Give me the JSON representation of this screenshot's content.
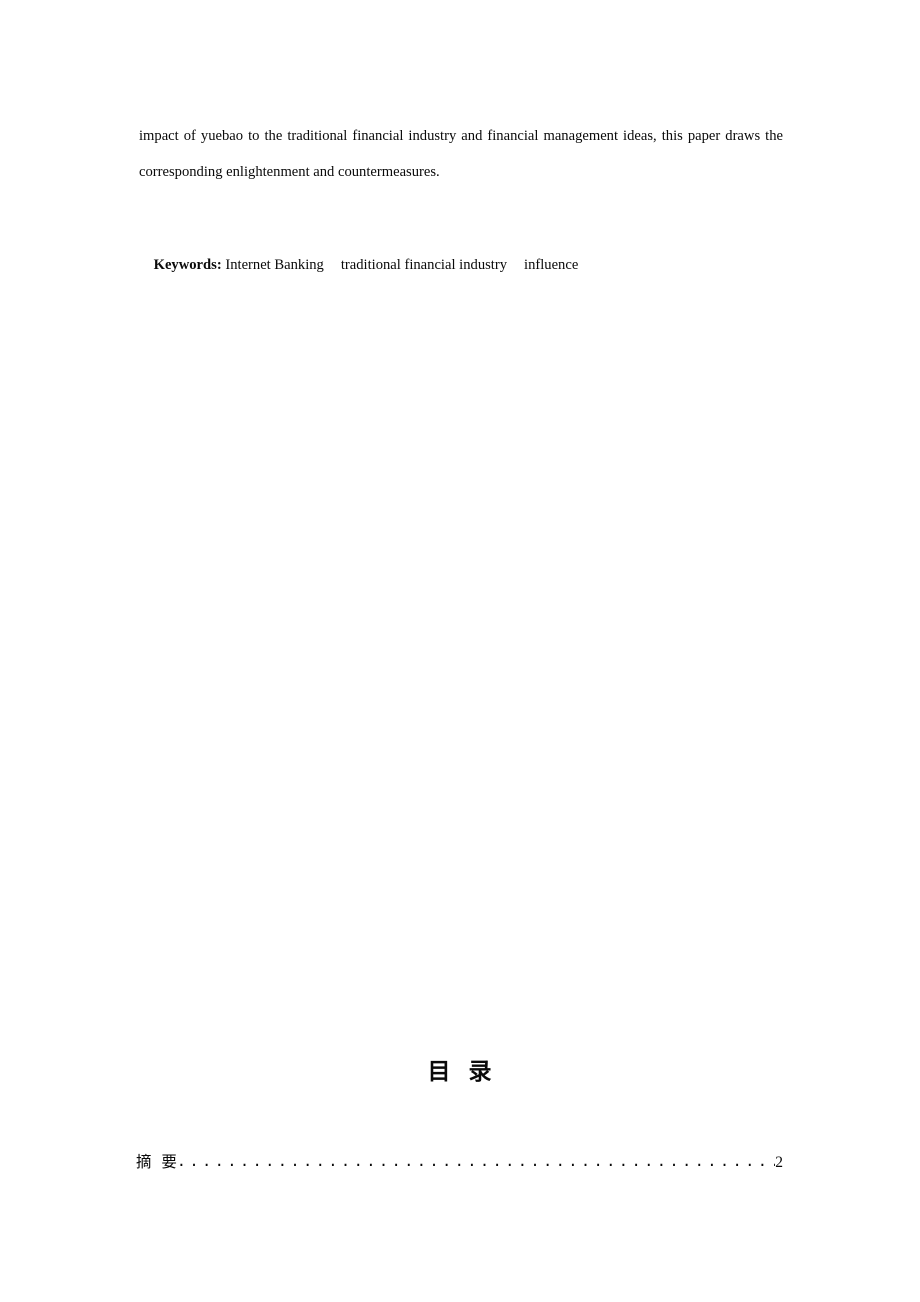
{
  "document": {
    "page_background": "#ffffff",
    "text_color": "#0a0a0a",
    "abstract": {
      "body_text": "impact of yuebao to the traditional financial industry and financial management ideas, this paper draws the corresponding enlightenment and countermeasures.",
      "keywords_label": "Keywords:",
      "keywords": [
        "Internet Banking",
        "traditional financial industry",
        "influence"
      ]
    },
    "toc": {
      "heading_char_1": "目",
      "heading_char_2": "录",
      "entries": [
        {
          "title": "摘  要",
          "leader": "........................................................",
          "page": "2"
        }
      ]
    }
  }
}
